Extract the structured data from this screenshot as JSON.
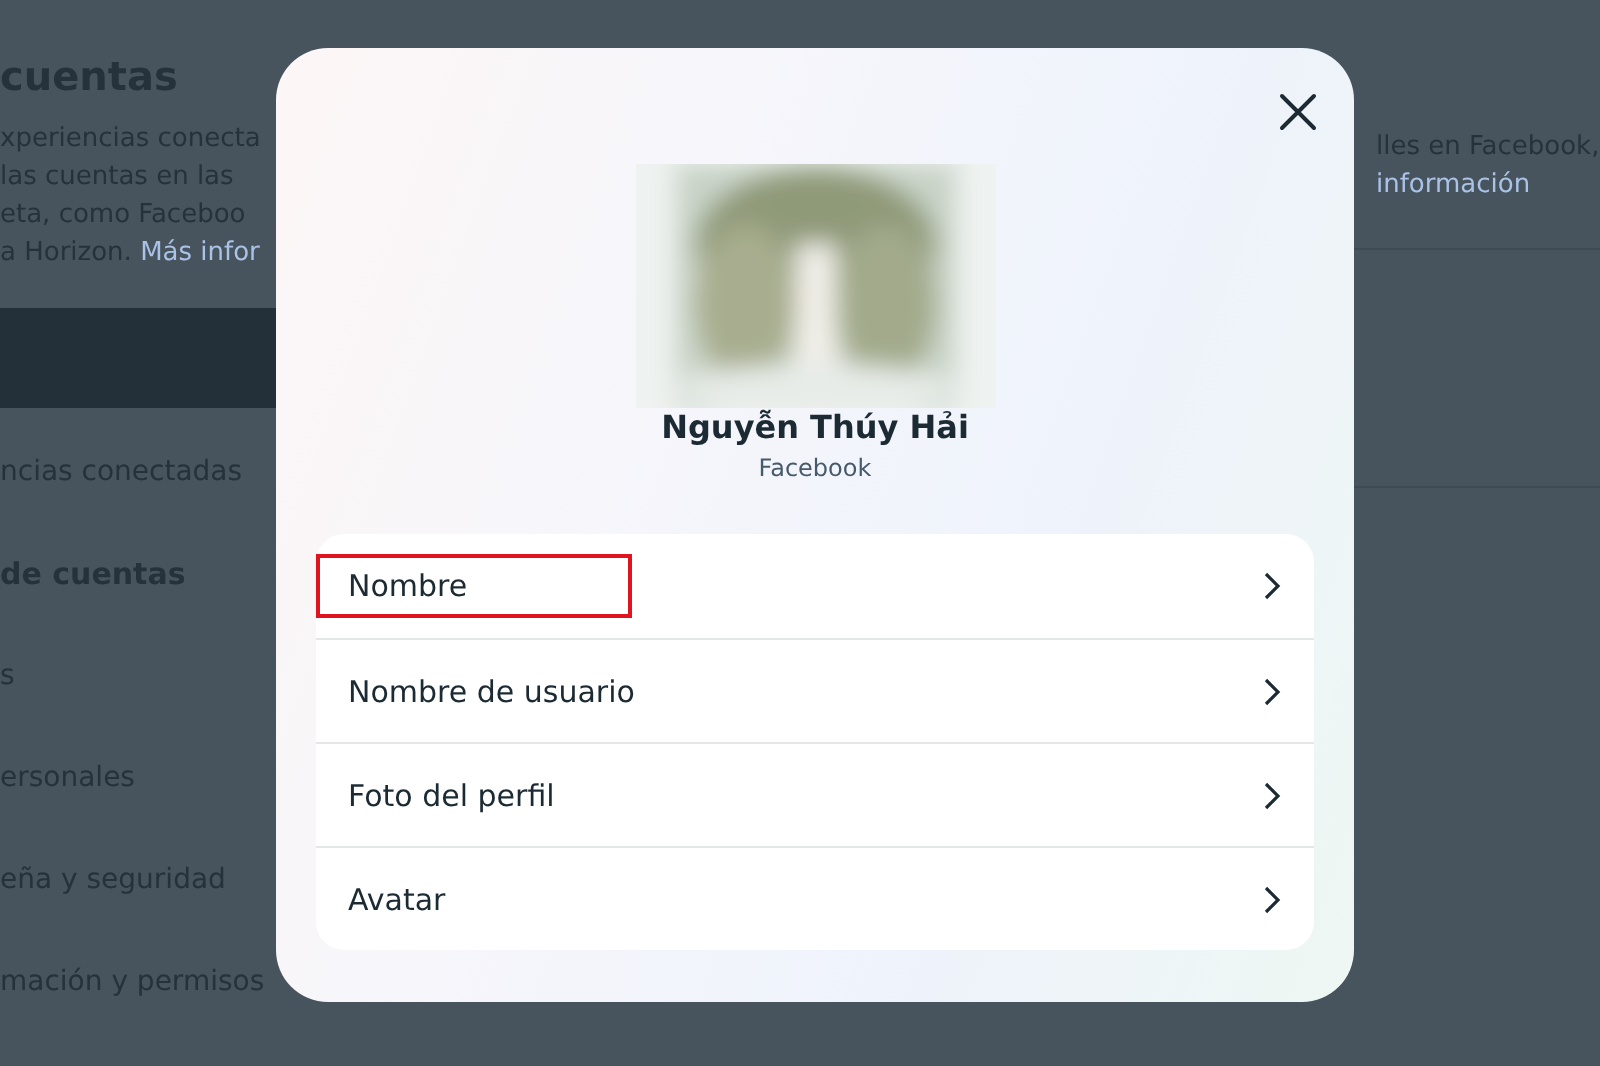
{
  "background": {
    "title": "cuentas",
    "description": [
      "xperiencias conecta",
      "las cuentas en las",
      "eta, como Faceboo"
    ],
    "description_end": "a Horizon.",
    "more_link": "Más infor",
    "right_text": "lles en Facebook,",
    "right_link": "información",
    "menu": [
      {
        "label": "ncias conectadas",
        "kind": "item"
      },
      {
        "label": "de cuentas",
        "kind": "heading"
      },
      {
        "label": "s",
        "kind": "item"
      },
      {
        "label": "ersonales",
        "kind": "item"
      },
      {
        "label": "eña y seguridad",
        "kind": "item"
      },
      {
        "label": "mación y permisos",
        "kind": "item"
      }
    ]
  },
  "dialog": {
    "profile_name": "Nguyễn Thúy Hải",
    "platform": "Facebook",
    "items": [
      {
        "label": "Nombre",
        "highlighted": true
      },
      {
        "label": "Nombre de usuario",
        "highlighted": false
      },
      {
        "label": "Foto del perfil",
        "highlighted": false
      },
      {
        "label": "Avatar",
        "highlighted": false
      }
    ]
  }
}
